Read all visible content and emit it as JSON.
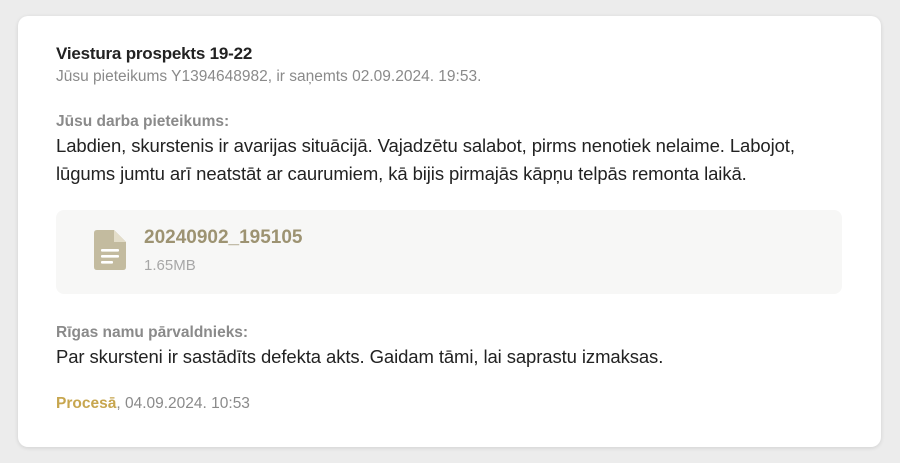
{
  "ticket": {
    "address": "Viestura prospekts 19-22",
    "received_line": "Jūsu pieteikums Y1394648982, ir saņemts 02.09.2024. 19:53."
  },
  "request": {
    "label": "Jūsu darba pieteikums:",
    "text": "Labdien, skurstenis ir avarijas situācijā. Vajadzētu salabot, pirms nenotiek nelaime. Labojot, lūgums jumtu arī neatstāt ar caurumiem, kā bijis pirmajās kāpņu telpās remonta laikā."
  },
  "attachment": {
    "icon": "document-icon",
    "name": "20240902_195105",
    "size": "1.65MB"
  },
  "response": {
    "label": "Rīgas namu pārvaldnieks:",
    "text": "Par skursteni ir sastādīts defekta akts. Gaidam tāmi, lai saprastu izmaksas."
  },
  "status": {
    "label": "Procesā",
    "separator": ",",
    "timestamp": "04.09.2024. 10:53"
  },
  "colors": {
    "status": "#c7a64f",
    "attachment_accent": "#9d9372",
    "muted_text": "#8a8a8a"
  }
}
